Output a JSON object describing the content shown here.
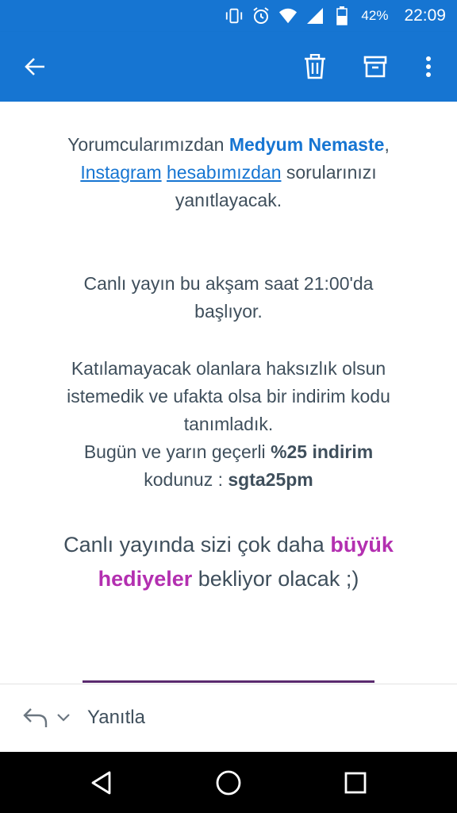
{
  "status_bar": {
    "icons": [
      "vibrate-icon",
      "alarm-icon",
      "wifi-icon",
      "signal-icon",
      "battery-icon"
    ],
    "battery_percent": "42%",
    "time": "22:09"
  },
  "app_bar": {
    "color": "#1675d2",
    "actions": [
      "back-arrow-icon",
      "trash-icon",
      "archive-icon",
      "more-vert-icon"
    ]
  },
  "message": {
    "p1": {
      "prefix": "Yorumcularımızdan ",
      "name": "Medyum Nemaste",
      "sep": ", ",
      "link1": "Instagram",
      "space": " ",
      "link2": "hesabımızdan",
      "suffix": " sorularınızı yanıtlayacak."
    },
    "p2": "Canlı yayın bu akşam saat 21:00'da başlıyor.",
    "p3": {
      "line1": "Katılamayacak olanlara haksızlık olsun istemedik ve ufakta olsa bir indirim kodu tanımladık.",
      "line2_prefix": "Bugün ve yarın geçerli ",
      "line2_bold": "%25 indirim",
      "line3_prefix": "kodunuz : ",
      "code": "sgta25pm"
    },
    "p4": {
      "prefix": "Canlı yayında sizi çok daha ",
      "highlight": "büyük hediyeler",
      "suffix": " bekliyor olacak ;)"
    },
    "colors": {
      "text": "#3f4f5c",
      "accent_blue": "#1675d2",
      "accent_purple": "#b32fb0",
      "divider": "#5a2a6e"
    }
  },
  "reply_bar": {
    "label": "Yanıtla",
    "icons": [
      "reply-icon",
      "chevron-down-icon"
    ]
  },
  "nav_bar": {
    "icons": [
      "nav-back-icon",
      "nav-home-icon",
      "nav-recent-icon"
    ]
  }
}
